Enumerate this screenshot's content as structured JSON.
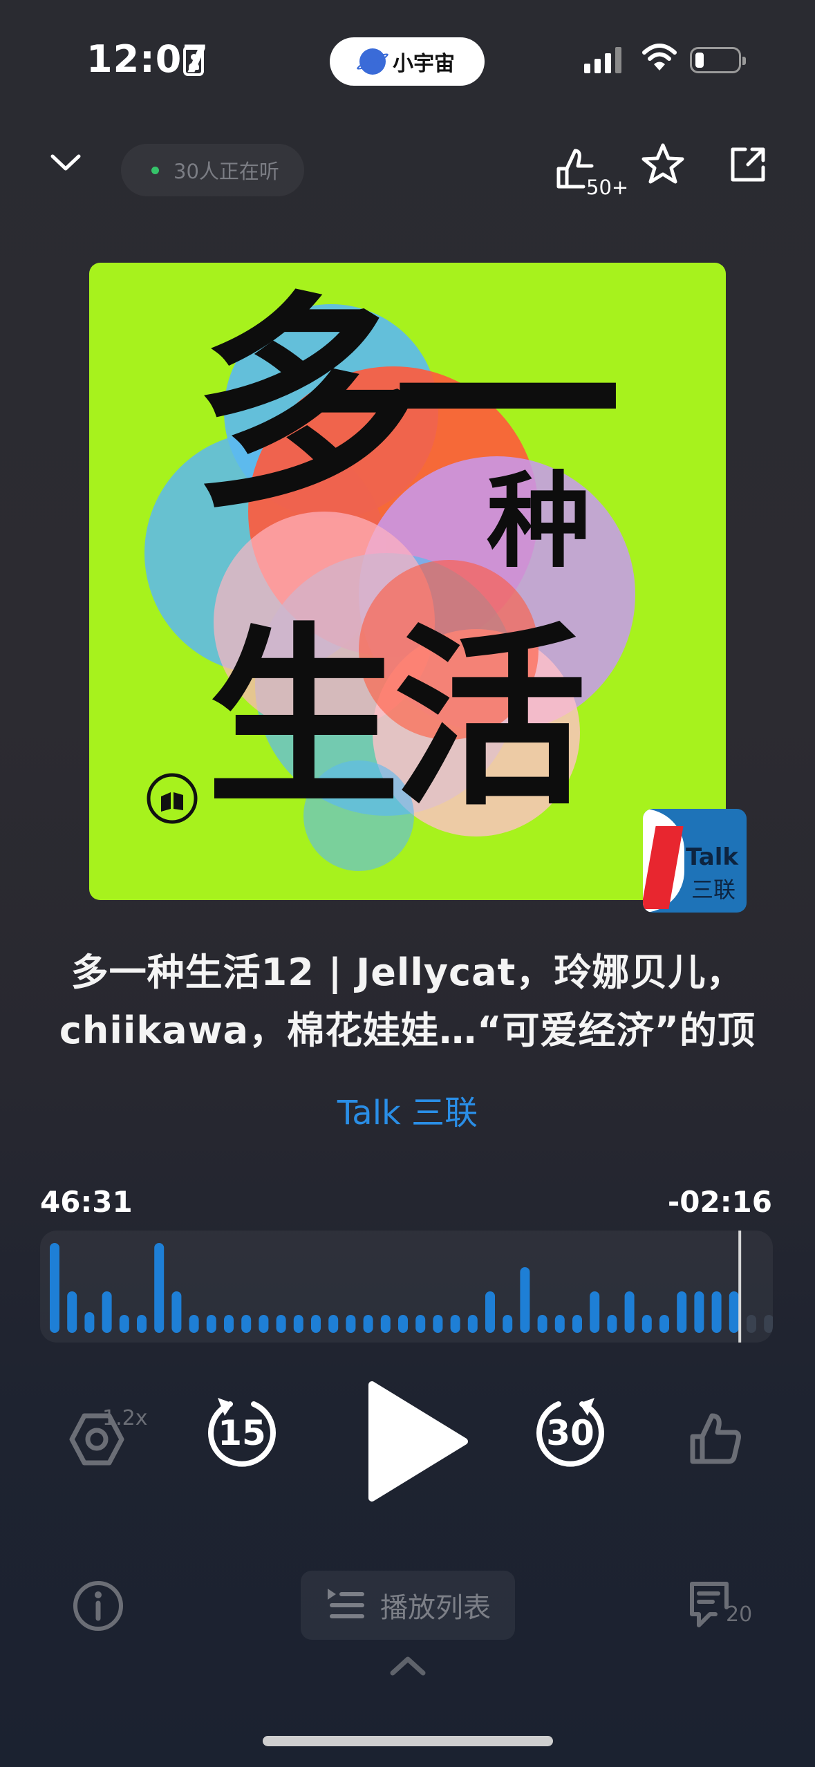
{
  "status_bar": {
    "time": "12:07",
    "app_pill": "小宇宙"
  },
  "header": {
    "listeners": "30人正在听",
    "upvote_count": "50+"
  },
  "cover": {
    "main_text_1": "多一",
    "main_text_2": "种",
    "main_text_3": "生活",
    "badge_talk": "Talk",
    "badge_cn": "三联",
    "background_color": "#a7f21d"
  },
  "episode": {
    "title_line1": "多一种生活12 | Jellycat，玲娜贝儿，",
    "title_line2": "chiikawa，棉花娃娃…“可爱经济”的顶",
    "author": "Talk 三联"
  },
  "progress": {
    "elapsed": "46:31",
    "remaining": "-02:16",
    "played_fraction": 0.953
  },
  "controls": {
    "speed": "1.2x",
    "rewind_seconds": "15",
    "forward_seconds": "30"
  },
  "bottom": {
    "playlist_label": "播放列表",
    "comment_count": "20"
  },
  "colors": {
    "accent_blue": "#2a8ee6",
    "bar_blue": "#1e7fd6",
    "muted_icon": "#6b6e76"
  },
  "icons": [
    "portrait-badge-icon",
    "signal-icon",
    "wifi-icon",
    "battery-icon",
    "chevron-down-icon",
    "thumbs-up-icon",
    "star-icon",
    "share-icon",
    "speed-icon",
    "rewind-15-icon",
    "play-icon",
    "forward-30-icon",
    "like-icon",
    "info-icon",
    "playlist-icon",
    "comment-icon",
    "chevron-up-icon"
  ]
}
